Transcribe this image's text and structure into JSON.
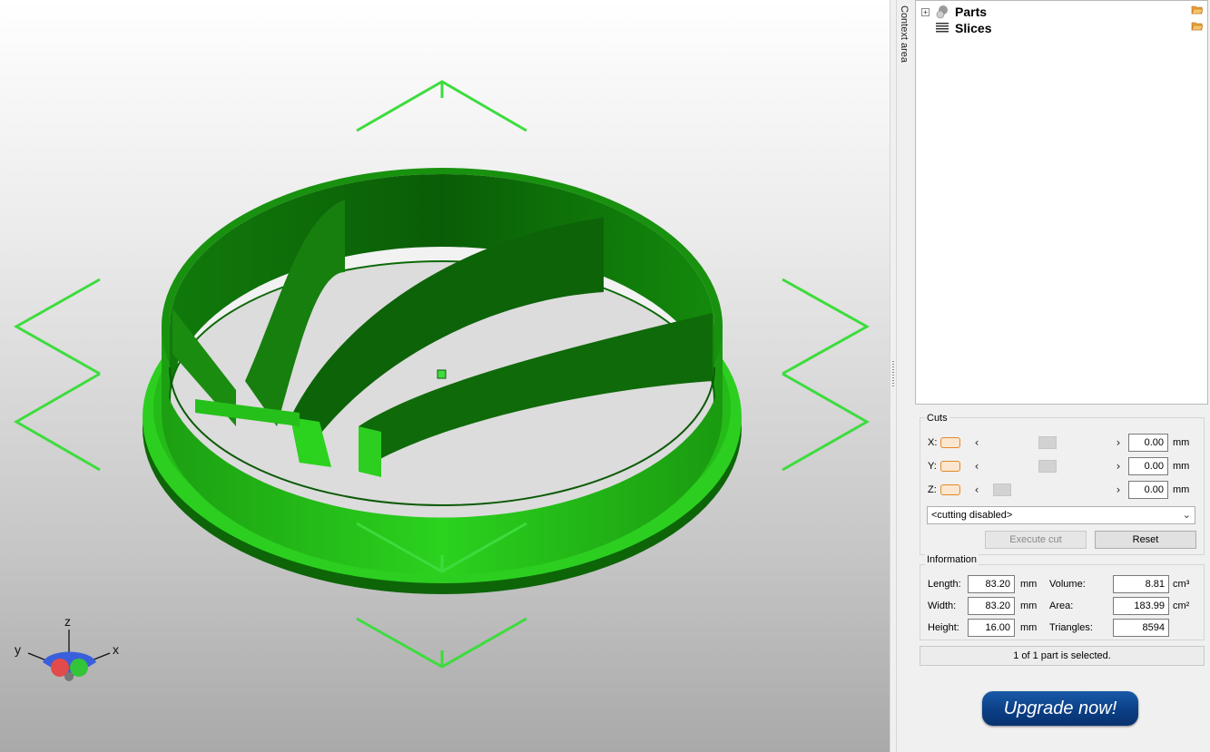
{
  "viewport": {
    "axes": {
      "x": "x",
      "y": "y",
      "z": "z"
    },
    "model_color": "#22cc22",
    "handle_color": "#44ee44"
  },
  "sidebar": {
    "tab_label": "Context area",
    "tree": [
      {
        "label": "Parts",
        "icon": "spheres-icon",
        "expandable": true
      },
      {
        "label": "Slices",
        "icon": "layers-icon",
        "expandable": false
      }
    ]
  },
  "cuts": {
    "title": "Cuts",
    "rows": [
      {
        "axis": "X:",
        "value": "0.00",
        "unit": "mm",
        "position": 0.5
      },
      {
        "axis": "Y:",
        "value": "0.00",
        "unit": "mm",
        "position": 0.5
      },
      {
        "axis": "Z:",
        "value": "0.00",
        "unit": "mm",
        "position": 0.1
      }
    ],
    "mode": "<cutting disabled>",
    "execute_label": "Execute cut",
    "reset_label": "Reset"
  },
  "information": {
    "title": "Information",
    "length_label": "Length:",
    "length_value": "83.20",
    "length_unit": "mm",
    "width_label": "Width:",
    "width_value": "83.20",
    "width_unit": "mm",
    "height_label": "Height:",
    "height_value": "16.00",
    "height_unit": "mm",
    "volume_label": "Volume:",
    "volume_value": "8.81",
    "volume_unit": "cm³",
    "area_label": "Area:",
    "area_value": "183.99",
    "area_unit": "cm²",
    "triangles_label": "Triangles:",
    "triangles_value": "8594"
  },
  "status": "1 of 1 part is selected.",
  "upgrade_label": "Upgrade now!",
  "colors": {
    "accent": "#e08a2a",
    "upgrade": "#0b3f86"
  }
}
